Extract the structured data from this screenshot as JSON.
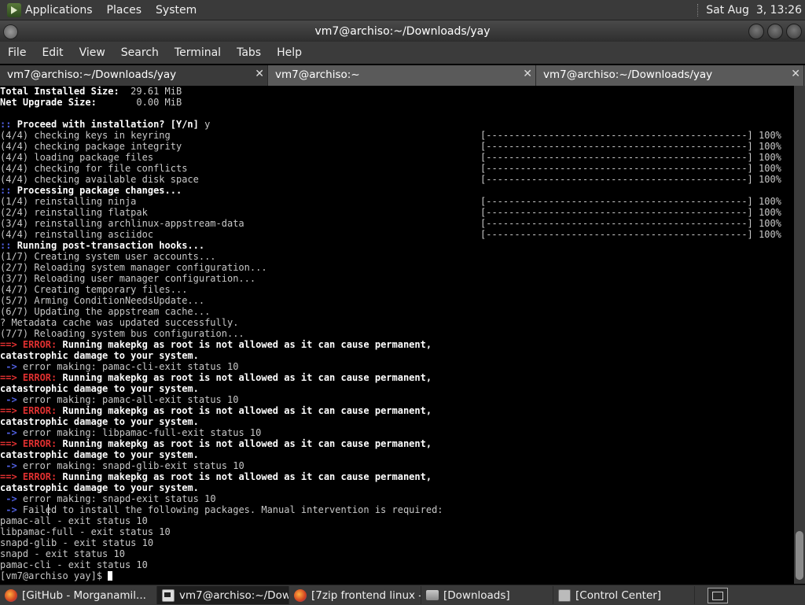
{
  "top_panel": {
    "menus": [
      "Applications",
      "Places",
      "System"
    ],
    "clock": "Sat Aug  3, 13:26"
  },
  "window": {
    "title": "vm7@archiso:~/Downloads/yay",
    "menu": [
      "File",
      "Edit",
      "View",
      "Search",
      "Terminal",
      "Tabs",
      "Help"
    ],
    "tabs": [
      {
        "label": "vm7@archiso:~/Downloads/yay",
        "close": "✕"
      },
      {
        "label": "vm7@archiso:~",
        "close": "✕"
      },
      {
        "label": "vm7@archiso:~/Downloads/yay",
        "close": "✕"
      }
    ]
  },
  "terminal": {
    "progress_bar": "[----------------------------------------------] 100%",
    "lines": [
      [
        {
          "t": "Total Installed Size:  ",
          "c": "b"
        },
        {
          "t": "29.61 MiB",
          "c": ""
        }
      ],
      [
        {
          "t": "Net Upgrade Size:      ",
          "c": "b"
        },
        {
          "t": " 0.00 MiB",
          "c": ""
        }
      ],
      [],
      [
        {
          "t": ":: ",
          "c": "blue"
        },
        {
          "t": "Proceed with installation? [Y/n] ",
          "c": "b"
        },
        {
          "t": "y",
          "c": ""
        }
      ],
      [
        {
          "t": "(4/4) checking keys in keyring",
          "c": "",
          "bar": true
        }
      ],
      [
        {
          "t": "(4/4) checking package integrity",
          "c": "",
          "bar": true
        }
      ],
      [
        {
          "t": "(4/4) loading package files",
          "c": "",
          "bar": true
        }
      ],
      [
        {
          "t": "(4/4) checking for file conflicts",
          "c": "",
          "bar": true
        }
      ],
      [
        {
          "t": "(4/4) checking available disk space",
          "c": "",
          "bar": true
        }
      ],
      [
        {
          "t": ":: ",
          "c": "blue"
        },
        {
          "t": "Processing package changes...",
          "c": "b"
        }
      ],
      [
        {
          "t": "(1/4) reinstalling ninja",
          "c": "",
          "bar": true
        }
      ],
      [
        {
          "t": "(2/4) reinstalling flatpak",
          "c": "",
          "bar": true
        }
      ],
      [
        {
          "t": "(3/4) reinstalling archlinux-appstream-data",
          "c": "",
          "bar": true
        }
      ],
      [
        {
          "t": "(4/4) reinstalling asciidoc",
          "c": "",
          "bar": true
        }
      ],
      [
        {
          "t": ":: ",
          "c": "blue"
        },
        {
          "t": "Running post-transaction hooks...",
          "c": "b"
        }
      ],
      [
        {
          "t": "(1/7) Creating system user accounts...",
          "c": ""
        }
      ],
      [
        {
          "t": "(2/7) Reloading system manager configuration...",
          "c": ""
        }
      ],
      [
        {
          "t": "(3/7) Reloading user manager configuration...",
          "c": ""
        }
      ],
      [
        {
          "t": "(4/7) Creating temporary files...",
          "c": ""
        }
      ],
      [
        {
          "t": "(5/7) Arming ConditionNeedsUpdate...",
          "c": ""
        }
      ],
      [
        {
          "t": "(6/7) Updating the appstream cache...",
          "c": ""
        }
      ],
      [
        {
          "t": "? Metadata cache was updated successfully.",
          "c": ""
        }
      ],
      [
        {
          "t": "(7/7) Reloading system bus configuration...",
          "c": ""
        }
      ],
      [
        {
          "t": "==> ERROR: ",
          "c": "red"
        },
        {
          "t": "Running makepkg as root is not allowed as it can cause permanent,",
          "c": "b"
        }
      ],
      [
        {
          "t": "catastrophic damage to your system.",
          "c": "b"
        }
      ],
      [
        {
          "t": " -> ",
          "c": "blue"
        },
        {
          "t": "error making: pamac-cli-exit status 10",
          "c": ""
        }
      ],
      [
        {
          "t": "==> ERROR: ",
          "c": "red"
        },
        {
          "t": "Running makepkg as root is not allowed as it can cause permanent,",
          "c": "b"
        }
      ],
      [
        {
          "t": "catastrophic damage to your system.",
          "c": "b"
        }
      ],
      [
        {
          "t": " -> ",
          "c": "blue"
        },
        {
          "t": "error making: pamac-all-exit status 10",
          "c": ""
        }
      ],
      [
        {
          "t": "==> ERROR: ",
          "c": "red"
        },
        {
          "t": "Running makepkg as root is not allowed as it can cause permanent,",
          "c": "b"
        }
      ],
      [
        {
          "t": "catastrophic damage to your system.",
          "c": "b"
        }
      ],
      [
        {
          "t": " -> ",
          "c": "blue"
        },
        {
          "t": "error making: libpamac-full-exit status 10",
          "c": ""
        }
      ],
      [
        {
          "t": "==> ERROR: ",
          "c": "red"
        },
        {
          "t": "Running makepkg as root is not allowed as it can cause permanent,",
          "c": "b"
        }
      ],
      [
        {
          "t": "catastrophic damage to your system.",
          "c": "b"
        }
      ],
      [
        {
          "t": " -> ",
          "c": "blue"
        },
        {
          "t": "error making: snapd-glib-exit status 10",
          "c": ""
        }
      ],
      [
        {
          "t": "==> ERROR: ",
          "c": "red"
        },
        {
          "t": "Running makepkg as root is not allowed as it can cause permanent,",
          "c": "b"
        }
      ],
      [
        {
          "t": "catastrophic damage to your system.",
          "c": "b"
        }
      ],
      [
        {
          "t": " -> ",
          "c": "blue"
        },
        {
          "t": "error making: snapd-exit status 10",
          "c": ""
        }
      ],
      [
        {
          "t": " -> ",
          "c": "blue"
        },
        {
          "t": "Failed to install the following packages. Manual intervention is required:",
          "c": ""
        }
      ],
      [
        {
          "t": "pamac-all - exit status 10",
          "c": ""
        }
      ],
      [
        {
          "t": "libpamac-full - exit status 10",
          "c": ""
        }
      ],
      [
        {
          "t": "snapd-glib - exit status 10",
          "c": ""
        }
      ],
      [
        {
          "t": "snapd - exit status 10",
          "c": ""
        }
      ],
      [
        {
          "t": "pamac-cli - exit status 10",
          "c": ""
        }
      ],
      [
        {
          "t": "[vm7@archiso yay]$ ",
          "c": "",
          "cursor": true
        }
      ]
    ]
  },
  "taskbar": {
    "items": [
      {
        "label": "[GitHub - Morganamil...",
        "icon": "firefox-icon",
        "active": false
      },
      {
        "label": "vm7@archiso:~/Dow...",
        "icon": "terminal-icon",
        "active": true
      },
      {
        "label": "[7zip frontend linux - ...",
        "icon": "firefox-icon",
        "active": false
      },
      {
        "label": "[Downloads]",
        "icon": "folder-icon",
        "active": false
      },
      {
        "label": "[Control Center]",
        "icon": "control-center-icon",
        "active": false
      }
    ]
  }
}
